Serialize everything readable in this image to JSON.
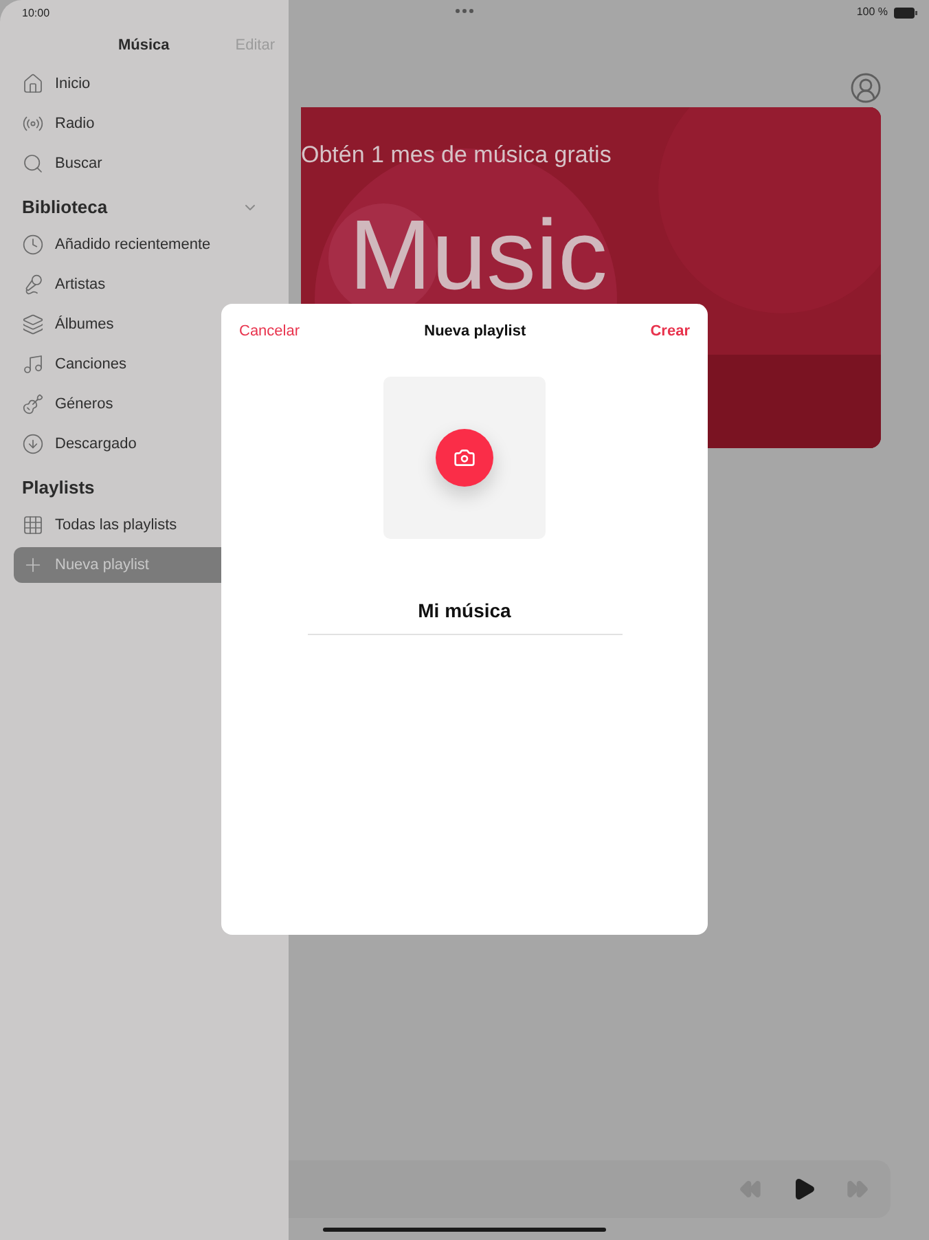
{
  "status_bar": {
    "time": "10:00",
    "battery": "100 %"
  },
  "sidebar": {
    "title": "Música",
    "edit": "Editar",
    "items": [
      {
        "label": "Inicio",
        "selected": false
      },
      {
        "label": "Radio",
        "selected": false
      },
      {
        "label": "Buscar",
        "selected": false
      }
    ],
    "sections": [
      {
        "title": "Biblioteca",
        "expanded": true,
        "items": [
          {
            "label": "Añadido recientemente",
            "selected": false
          },
          {
            "label": "Artistas",
            "selected": false
          },
          {
            "label": "Álbumes",
            "selected": false
          },
          {
            "label": "Canciones",
            "selected": false
          },
          {
            "label": "Géneros",
            "selected": false
          },
          {
            "label": "Descargado",
            "selected": false
          }
        ]
      },
      {
        "title": "Playlists",
        "items": [
          {
            "label": "Todas las playlists",
            "selected": false
          },
          {
            "label": "Nueva playlist",
            "selected": true
          }
        ]
      }
    ]
  },
  "banner": {
    "headline": "Obtén 1 mes de música gratis",
    "logo_text": "Music"
  },
  "dialog": {
    "cancel": "Cancelar",
    "title": "Nueva playlist",
    "create": "Crear",
    "name_value": "Mi música"
  }
}
